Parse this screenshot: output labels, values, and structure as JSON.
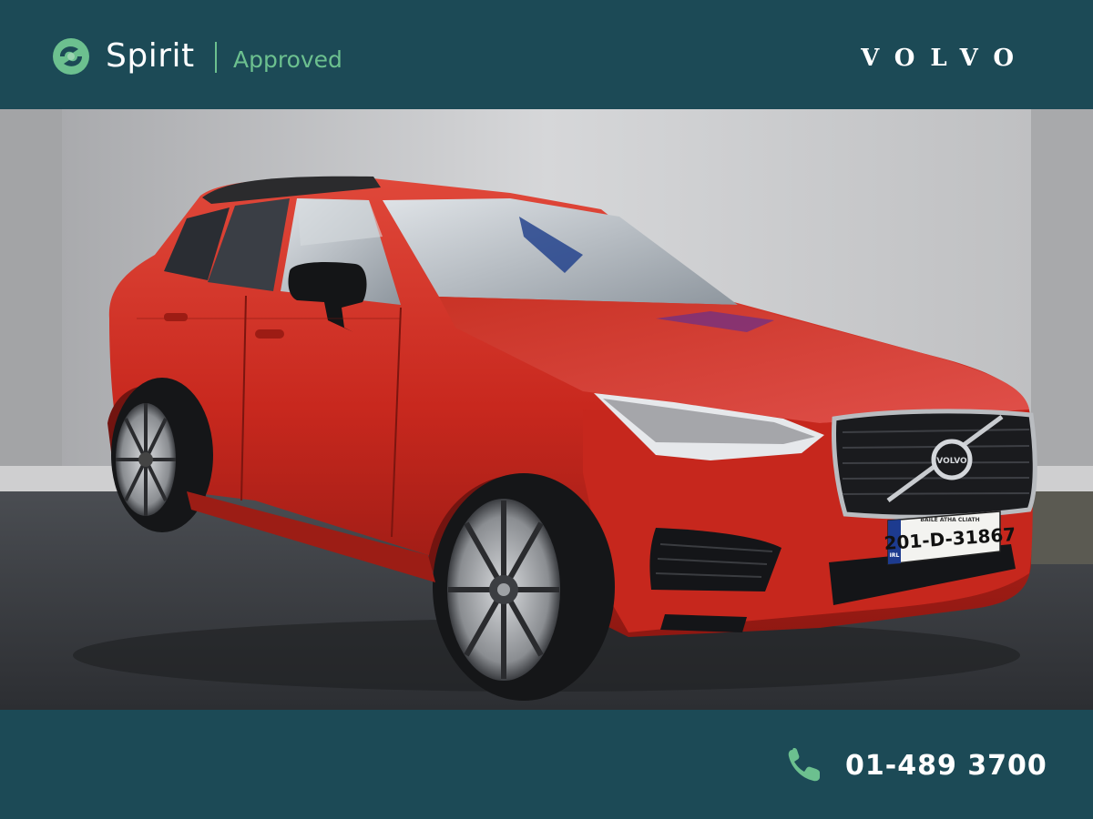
{
  "header": {
    "brand_name": "Spirit",
    "brand_tagline": "Approved",
    "manufacturer": "VOLVO",
    "icons": [
      "spirit-logo-icon"
    ],
    "colors": {
      "background": "#1c4a56",
      "brand_accent": "#6cc08f",
      "text": "#ffffff"
    }
  },
  "photo": {
    "car_color": "#c8281e",
    "plate": "201-D-31867",
    "plate_country": "IRL",
    "plate_header": "BAILE ÁTHA CLIATH",
    "grille_badge": "VOLVO"
  },
  "footer": {
    "phone": "01-489 3700",
    "icons": [
      "phone-icon"
    ],
    "colors": {
      "background": "#1c4a56",
      "icon": "#6cc08f"
    }
  }
}
